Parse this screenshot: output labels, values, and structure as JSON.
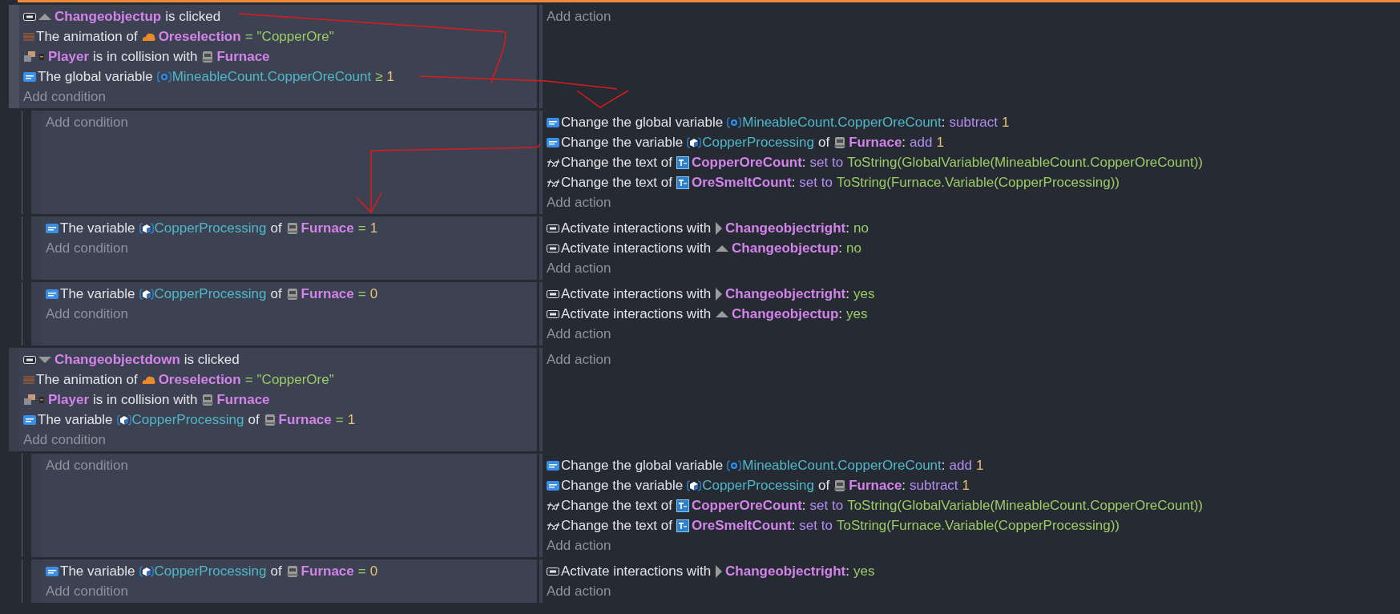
{
  "events": [
    {
      "selected": true,
      "conditions": [
        {
          "kind": "click",
          "parts": [
            {
              "kind": "upbutton",
              "text": "Changeobjectup"
            },
            {
              "kind": "text",
              "text": "is clicked"
            }
          ]
        },
        {
          "kind": "animation",
          "parts": [
            {
              "kind": "text",
              "text": "The animation of"
            },
            {
              "kind": "ore",
              "text": "Oreselection"
            },
            {
              "kind": "operator",
              "text": "="
            },
            {
              "kind": "string",
              "text": "\"CopperOre\""
            }
          ]
        },
        {
          "kind": "collision",
          "parts": [
            {
              "kind": "player",
              "text": "Player"
            },
            {
              "kind": "text",
              "text": "is in collision with"
            },
            {
              "kind": "furnace",
              "text": "Furnace"
            }
          ]
        },
        {
          "kind": "variable",
          "parts": [
            {
              "kind": "text",
              "text": "The global variable"
            },
            {
              "kind": "globalvar",
              "text": "MineableCount.CopperOreCount"
            },
            {
              "kind": "operator",
              "text": "≥"
            },
            {
              "kind": "number",
              "text": "1"
            }
          ]
        }
      ],
      "add_condition": "Add condition",
      "add_action": "Add action",
      "children": [
        {
          "selected": false,
          "add_condition": "Add condition",
          "actions": [
            {
              "kind": "variable",
              "parts": [
                {
                  "kind": "text",
                  "text": "Change the global variable"
                },
                {
                  "kind": "globalvar",
                  "text": "MineableCount.CopperOreCount"
                },
                {
                  "kind": "punct",
                  "text": ":"
                },
                {
                  "kind": "operation",
                  "text": "subtract"
                },
                {
                  "kind": "number",
                  "text": "1"
                }
              ]
            },
            {
              "kind": "variable",
              "parts": [
                {
                  "kind": "text",
                  "text": "Change the variable"
                },
                {
                  "kind": "objectvar",
                  "text": "CopperProcessing"
                },
                {
                  "kind": "text",
                  "text": "of"
                },
                {
                  "kind": "furnace",
                  "text": "Furnace"
                },
                {
                  "kind": "punct",
                  "text": ":"
                },
                {
                  "kind": "operation",
                  "text": "add"
                },
                {
                  "kind": "number",
                  "text": "1"
                }
              ]
            },
            {
              "kind": "text",
              "parts": [
                {
                  "kind": "text",
                  "text": "Change the text of"
                },
                {
                  "kind": "textobject",
                  "text": "CopperOreCount"
                },
                {
                  "kind": "punct",
                  "text": ":"
                },
                {
                  "kind": "operation",
                  "text": "set to"
                },
                {
                  "kind": "expression",
                  "text": "ToString(GlobalVariable(MineableCount.CopperOreCount))"
                }
              ]
            },
            {
              "kind": "text",
              "parts": [
                {
                  "kind": "text",
                  "text": "Change the text of"
                },
                {
                  "kind": "textobject",
                  "text": "OreSmeltCount"
                },
                {
                  "kind": "punct",
                  "text": ":"
                },
                {
                  "kind": "operation",
                  "text": "set to"
                },
                {
                  "kind": "expression",
                  "text": "ToString(Furnace.Variable(CopperProcessing))"
                }
              ]
            }
          ],
          "add_action": "Add action"
        },
        {
          "selected": false,
          "conditions": [
            {
              "kind": "variable",
              "parts": [
                {
                  "kind": "text",
                  "text": "The variable"
                },
                {
                  "kind": "objectvar",
                  "text": "CopperProcessing"
                },
                {
                  "kind": "text",
                  "text": "of"
                },
                {
                  "kind": "furnace",
                  "text": "Furnace"
                },
                {
                  "kind": "operator",
                  "text": "="
                },
                {
                  "kind": "number",
                  "text": "1"
                }
              ]
            }
          ],
          "add_condition": "Add condition",
          "actions": [
            {
              "kind": "click",
              "parts": [
                {
                  "kind": "text",
                  "text": "Activate interactions with"
                },
                {
                  "kind": "rightbutton",
                  "text": "Changeobjectright"
                },
                {
                  "kind": "punct",
                  "text": ":"
                },
                {
                  "kind": "string",
                  "text": "no"
                }
              ]
            },
            {
              "kind": "click",
              "parts": [
                {
                  "kind": "text",
                  "text": "Activate interactions with"
                },
                {
                  "kind": "upbutton",
                  "text": "Changeobjectup"
                },
                {
                  "kind": "punct",
                  "text": ":"
                },
                {
                  "kind": "string",
                  "text": "no"
                }
              ]
            }
          ],
          "add_action": "Add action"
        },
        {
          "selected": false,
          "conditions": [
            {
              "kind": "variable",
              "parts": [
                {
                  "kind": "text",
                  "text": "The variable"
                },
                {
                  "kind": "objectvar",
                  "text": "CopperProcessing"
                },
                {
                  "kind": "text",
                  "text": "of"
                },
                {
                  "kind": "furnace",
                  "text": "Furnace"
                },
                {
                  "kind": "operator",
                  "text": "="
                },
                {
                  "kind": "number",
                  "text": "0"
                }
              ]
            }
          ],
          "add_condition": "Add condition",
          "actions": [
            {
              "kind": "click",
              "parts": [
                {
                  "kind": "text",
                  "text": "Activate interactions with"
                },
                {
                  "kind": "rightbutton",
                  "text": "Changeobjectright"
                },
                {
                  "kind": "punct",
                  "text": ":"
                },
                {
                  "kind": "string",
                  "text": "yes"
                }
              ]
            },
            {
              "kind": "click",
              "parts": [
                {
                  "kind": "text",
                  "text": "Activate interactions with"
                },
                {
                  "kind": "upbutton",
                  "text": "Changeobjectup"
                },
                {
                  "kind": "punct",
                  "text": ":"
                },
                {
                  "kind": "string",
                  "text": "yes"
                }
              ]
            }
          ],
          "add_action": "Add action"
        }
      ]
    },
    {
      "selected": false,
      "conditions": [
        {
          "kind": "click",
          "parts": [
            {
              "kind": "downbutton",
              "text": "Changeobjectdown"
            },
            {
              "kind": "text",
              "text": "is clicked"
            }
          ]
        },
        {
          "kind": "animation",
          "parts": [
            {
              "kind": "text",
              "text": "The animation of"
            },
            {
              "kind": "ore",
              "text": "Oreselection"
            },
            {
              "kind": "operator",
              "text": "="
            },
            {
              "kind": "string",
              "text": "\"CopperOre\""
            }
          ]
        },
        {
          "kind": "collision",
          "parts": [
            {
              "kind": "player",
              "text": "Player"
            },
            {
              "kind": "text",
              "text": "is in collision with"
            },
            {
              "kind": "furnace",
              "text": "Furnace"
            }
          ]
        },
        {
          "kind": "variable",
          "parts": [
            {
              "kind": "text",
              "text": "The variable"
            },
            {
              "kind": "objectvar",
              "text": "CopperProcessing"
            },
            {
              "kind": "text",
              "text": "of"
            },
            {
              "kind": "furnace",
              "text": "Furnace"
            },
            {
              "kind": "operator",
              "text": "="
            },
            {
              "kind": "number",
              "text": "1"
            }
          ]
        }
      ],
      "add_condition": "Add condition",
      "add_action": "Add action",
      "children": [
        {
          "selected": false,
          "add_condition": "Add condition",
          "actions": [
            {
              "kind": "variable",
              "parts": [
                {
                  "kind": "text",
                  "text": "Change the global variable"
                },
                {
                  "kind": "globalvar",
                  "text": "MineableCount.CopperOreCount"
                },
                {
                  "kind": "punct",
                  "text": ":"
                },
                {
                  "kind": "operation",
                  "text": "add"
                },
                {
                  "kind": "number",
                  "text": "1"
                }
              ]
            },
            {
              "kind": "variable",
              "parts": [
                {
                  "kind": "text",
                  "text": "Change the variable"
                },
                {
                  "kind": "objectvar",
                  "text": "CopperProcessing"
                },
                {
                  "kind": "text",
                  "text": "of"
                },
                {
                  "kind": "furnace",
                  "text": "Furnace"
                },
                {
                  "kind": "punct",
                  "text": ":"
                },
                {
                  "kind": "operation",
                  "text": "subtract"
                },
                {
                  "kind": "number",
                  "text": "1"
                }
              ]
            },
            {
              "kind": "text",
              "parts": [
                {
                  "kind": "text",
                  "text": "Change the text of"
                },
                {
                  "kind": "textobject",
                  "text": "CopperOreCount"
                },
                {
                  "kind": "punct",
                  "text": ":"
                },
                {
                  "kind": "operation",
                  "text": "set to"
                },
                {
                  "kind": "expression",
                  "text": "ToString(GlobalVariable(MineableCount.CopperOreCount))"
                }
              ]
            },
            {
              "kind": "text",
              "parts": [
                {
                  "kind": "text",
                  "text": "Change the text of"
                },
                {
                  "kind": "textobject",
                  "text": "OreSmeltCount"
                },
                {
                  "kind": "punct",
                  "text": ":"
                },
                {
                  "kind": "operation",
                  "text": "set to"
                },
                {
                  "kind": "expression",
                  "text": "ToString(Furnace.Variable(CopperProcessing))"
                }
              ]
            }
          ],
          "add_action": "Add action"
        },
        {
          "selected": false,
          "conditions": [
            {
              "kind": "variable",
              "parts": [
                {
                  "kind": "text",
                  "text": "The variable"
                },
                {
                  "kind": "objectvar",
                  "text": "CopperProcessing"
                },
                {
                  "kind": "text",
                  "text": "of"
                },
                {
                  "kind": "furnace",
                  "text": "Furnace"
                },
                {
                  "kind": "operator",
                  "text": "="
                },
                {
                  "kind": "number",
                  "text": "0"
                }
              ]
            }
          ],
          "add_condition": "Add condition",
          "actions": [
            {
              "kind": "click",
              "parts": [
                {
                  "kind": "text",
                  "text": "Activate interactions with"
                },
                {
                  "kind": "rightbutton",
                  "text": "Changeobjectright"
                },
                {
                  "kind": "punct",
                  "text": ":"
                },
                {
                  "kind": "string",
                  "text": "yes"
                }
              ]
            }
          ],
          "add_action": "Add action"
        }
      ]
    }
  ]
}
